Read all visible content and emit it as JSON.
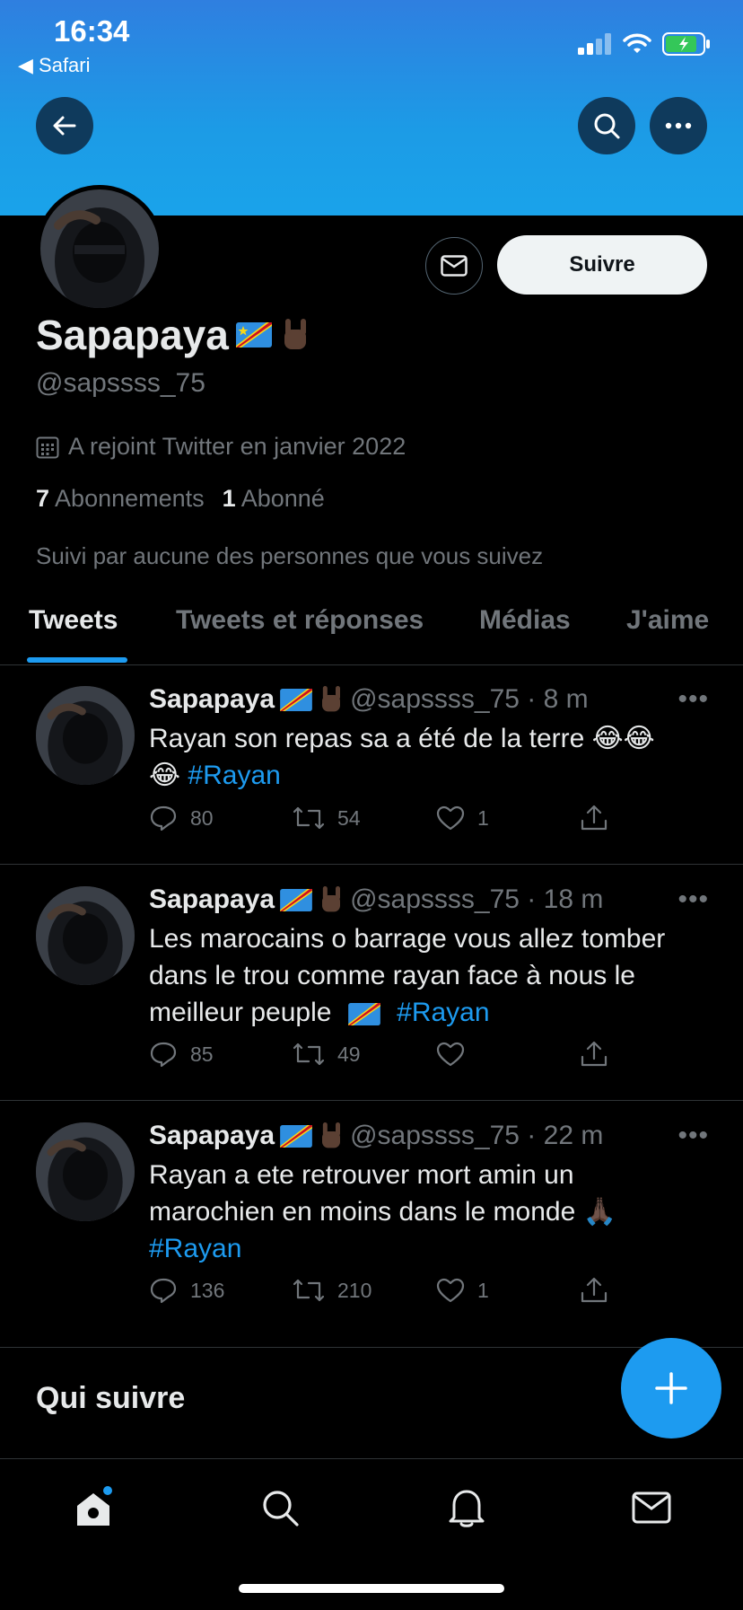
{
  "status_bar": {
    "time": "16:34",
    "back_app": "◀ Safari"
  },
  "profile": {
    "display_name": "Sapapaya",
    "handle": "@sapssss_75",
    "joined": "A rejoint Twitter en janvier 2022",
    "following_count": "7",
    "following_label": "Abonnements",
    "followers_count": "1",
    "followers_label": "Abonné",
    "followed_by": "Suivi par aucune des personnes que vous suivez",
    "follow_button": "Suivre"
  },
  "tabs": [
    {
      "label": "Tweets",
      "active": true
    },
    {
      "label": "Tweets et réponses",
      "active": false
    },
    {
      "label": "Médias",
      "active": false
    },
    {
      "label": "J'aime",
      "active": false
    }
  ],
  "tweets": [
    {
      "name": "Sapapaya",
      "meta": "@sapssss_75 · 8 m",
      "text_line1": "Rayan son repas sa a été de la terre 😂😂",
      "text_line2_emoji": "😂",
      "hashtag": "#Rayan",
      "replies": "80",
      "retweets": "54",
      "likes": "1"
    },
    {
      "name": "Sapapaya",
      "meta": "@sapssss_75 · 18 m",
      "text_line1": "Les marocains o barrage vous allez tomber",
      "text_line2": "dans le trou comme rayan face à nous le",
      "text_line3": "meilleur peuple",
      "hashtag": "#Rayan",
      "replies": "85",
      "retweets": "49",
      "likes": ""
    },
    {
      "name": "Sapapaya",
      "meta": "@sapssss_75 · 22 m",
      "text_line1": "Rayan a ete retrouver mort amin un",
      "text_line2": "marochien en moins dans le monde 🙏🏿",
      "hashtag": "#Rayan",
      "replies": "136",
      "retweets": "210",
      "likes": "1"
    }
  ],
  "who_to_follow": "Qui suivre",
  "colors": {
    "accent": "#1d9bf0",
    "banner": "#1c9be6",
    "muted": "#71767b",
    "divider": "#2f3336"
  },
  "icons": [
    "back-arrow-icon",
    "search-icon",
    "more-icon",
    "mail-icon",
    "calendar-icon",
    "reply-icon",
    "retweet-icon",
    "like-icon",
    "share-icon",
    "compose-icon",
    "home-icon",
    "bell-icon"
  ]
}
